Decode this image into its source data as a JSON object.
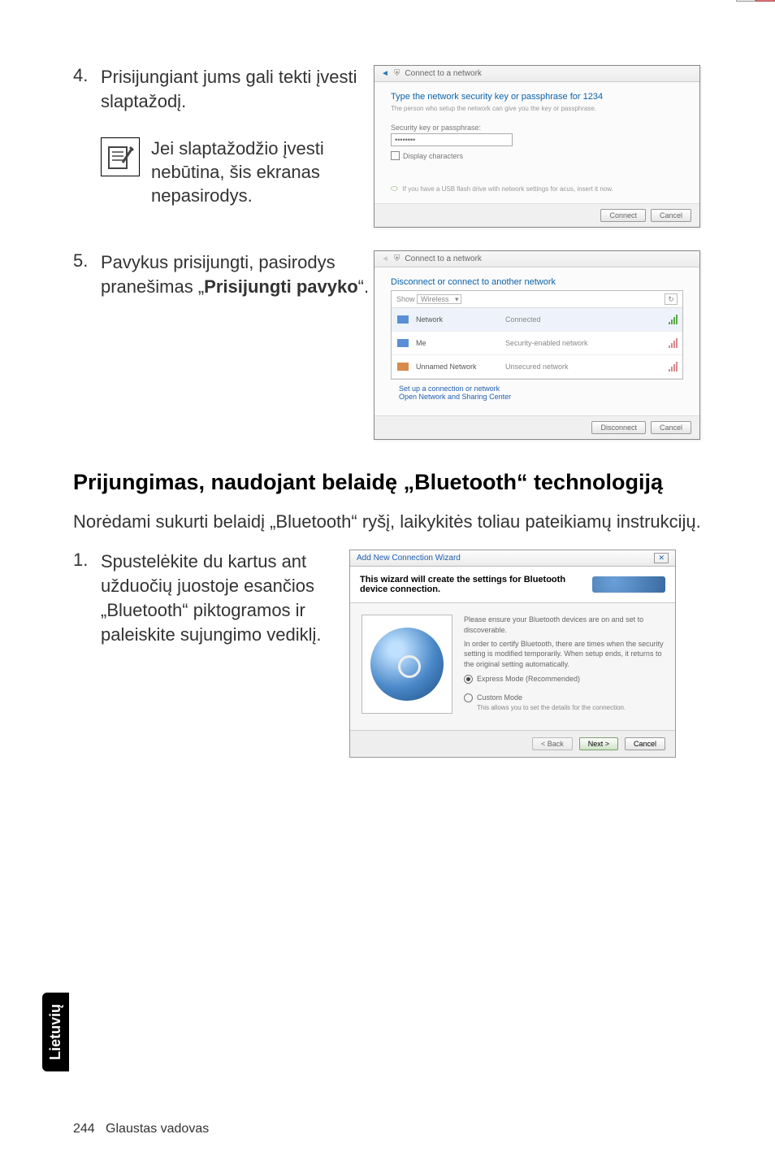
{
  "step4": {
    "num": "4.",
    "text": "Prisijungiant jums gali tekti įvesti slaptažodį.",
    "note": "Jei slaptažodžio įvesti nebūtina, šis ekranas nepasirodys."
  },
  "dialog1": {
    "title": "Connect to a network",
    "heading": "Type the network security key or passphrase for 1234",
    "sub": "The person who setup the network can give you the key or passphrase.",
    "label_key": "Security key or passphrase:",
    "key_value": "••••••••",
    "display_chars": "Display characters",
    "usb_hint": "If you have a USB flash drive with network settings for acus, insert it now.",
    "btn_connect": "Connect",
    "btn_cancel": "Cancel"
  },
  "step5": {
    "num": "5.",
    "text_a": "Pavykus prisijungti, pasirodys pranešimas „",
    "text_b": "Prisijungti pavyko",
    "text_c": "“."
  },
  "dialog2": {
    "title": "Connect to a network",
    "heading": "Disconnect or connect to another network",
    "show_label": "Show",
    "show_value": "Wireless",
    "rows": [
      {
        "name": "Network",
        "status": "Connected"
      },
      {
        "name": "Me",
        "status": "Security-enabled network"
      },
      {
        "name": "Unnamed Network",
        "status": "Unsecured network"
      }
    ],
    "link1": "Set up a connection or network",
    "link2": "Open Network and Sharing Center",
    "btn_disconnect": "Disconnect",
    "btn_cancel": "Cancel"
  },
  "section_title": "Prijungimas, naudojant belaidę „Bluetooth“ technologiją",
  "section_body": "Norėdami sukurti belaidį „Bluetooth“ ryšį, laikykitės toliau pateikiamų instrukcijų.",
  "step1": {
    "num": "1.",
    "text": "Spustelėkite du kartus ant užduočių juostoje esančios „Bluetooth“ piktogramos ir paleiskite sujungimo vediklį."
  },
  "bt_dialog": {
    "title": "Add New Connection Wizard",
    "close": "✕",
    "banner": "This wizard will create the settings for Bluetooth device connection.",
    "body_line1": "Please ensure your Bluetooth devices are on and set to discoverable.",
    "body_line2": "In order to certify Bluetooth, there are times when the security setting is modified temporarily. When setup ends, it returns to the original setting automatically.",
    "opt_express": "Express Mode (Recommended)",
    "opt_custom": "Custom Mode",
    "opt_custom_sub": "This allows you to set the details for the connection.",
    "btn_back": "< Back",
    "btn_next": "Next >",
    "btn_cancel": "Cancel"
  },
  "side_tab": "Lietuvių",
  "footer_page": "244",
  "footer_title": "Glaustas vadovas"
}
